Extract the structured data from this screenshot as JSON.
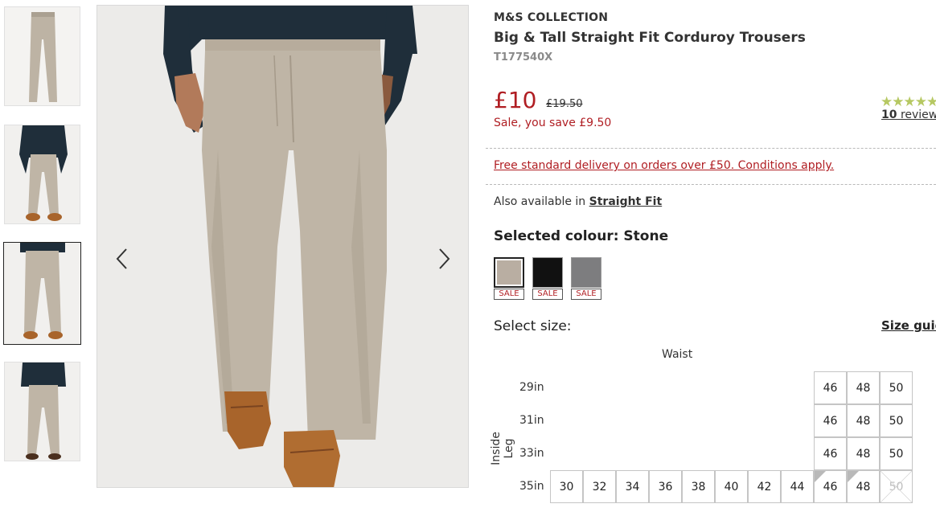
{
  "product": {
    "brand": "M&S COLLECTION",
    "title": "Big & Tall Straight Fit Corduroy Trousers",
    "code": "T177540X",
    "price": "£10",
    "old_price": "£19.50",
    "saving": "Sale, you save £9.50",
    "rating_stars": "★★★★★",
    "rating_value": 4.5,
    "review_count": "10",
    "review_label": "reviews"
  },
  "delivery": "Free standard delivery on orders over £50. Conditions apply.",
  "availability": {
    "prefix": "Also available in",
    "link": "Straight Fit"
  },
  "colour": {
    "label": "Selected colour: Stone",
    "swatches": [
      {
        "name": "Stone",
        "color": "#b9aea2",
        "badge": "SALE",
        "selected": true
      },
      {
        "name": "Black",
        "color": "#111111",
        "badge": "SALE",
        "selected": false
      },
      {
        "name": "Grey",
        "color": "#7d7d7f",
        "badge": "SALE",
        "selected": false
      }
    ]
  },
  "size": {
    "label": "Select size:",
    "guide": "Size guide",
    "waist_label": "Waist",
    "leg_label": "Inside Leg",
    "legs": [
      "29in",
      "31in",
      "33in",
      "35in"
    ],
    "rows": [
      [
        "46",
        "48",
        "50"
      ],
      [
        "46",
        "48",
        "50"
      ],
      [
        "46",
        "48",
        "50"
      ],
      [
        "30",
        "32",
        "34",
        "36",
        "38",
        "40",
        "42",
        "44",
        "46",
        "48",
        "50"
      ]
    ]
  },
  "gallery": {
    "thumbnails": [
      "thumbnail-front-flat",
      "thumbnail-front-model",
      "thumbnail-front-model-close",
      "thumbnail-back-model"
    ],
    "active_thumbnail": 2,
    "prev_icon": "chevron-left-icon",
    "next_icon": "chevron-right-icon"
  },
  "colors": {
    "accent_red": "#b01e23",
    "star_green": "#b6c862",
    "trouser_stone": "#bfb5a6"
  }
}
